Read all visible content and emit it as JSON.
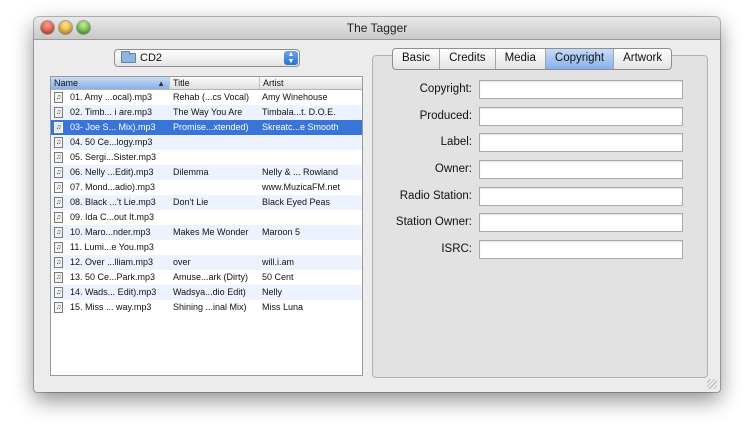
{
  "window": {
    "title": "The Tagger"
  },
  "folder_popup": {
    "selected": "CD2"
  },
  "table": {
    "columns": [
      "Name",
      "Title",
      "Artist"
    ],
    "rows": [
      {
        "name": "01. Amy ...ocal).mp3",
        "title": "Rehab (...cs Vocal)",
        "artist": "Amy Winehouse"
      },
      {
        "name": "02. Timb... i are.mp3",
        "title": "The Way You Are",
        "artist": "Timbala...t. D.O.E."
      },
      {
        "name": "03- Joe S... Mix).mp3",
        "title": "Promise...xtended)",
        "artist": "Skreatc...e Smooth"
      },
      {
        "name": "04. 50 Ce...logy.mp3",
        "title": "",
        "artist": ""
      },
      {
        "name": "05. Sergi...Sister.mp3",
        "title": "",
        "artist": ""
      },
      {
        "name": "06. Nelly ...Edit).mp3",
        "title": "Dilemma",
        "artist": "Nelly & ... Rowland"
      },
      {
        "name": "07. Mond...adio).mp3",
        "title": "",
        "artist": "www.MuzicaFM.net"
      },
      {
        "name": "08. Black ...'t Lie.mp3",
        "title": "Don't Lie",
        "artist": "Black Eyed Peas"
      },
      {
        "name": "09. Ida C...out It.mp3",
        "title": "",
        "artist": ""
      },
      {
        "name": "10. Maro...nder.mp3",
        "title": "Makes Me Wonder",
        "artist": "Maroon 5"
      },
      {
        "name": "11. Lumi...e You.mp3",
        "title": "",
        "artist": ""
      },
      {
        "name": "12. Over ...lliam.mp3",
        "title": "over",
        "artist": "will.i.am"
      },
      {
        "name": "13. 50 Ce...Park.mp3",
        "title": "Amuse...ark (Dirty)",
        "artist": "50 Cent"
      },
      {
        "name": "14. Wads... Edit).mp3",
        "title": "Wadsya...dio Edit)",
        "artist": "Nelly"
      },
      {
        "name": "15. Miss ... way.mp3",
        "title": "Shining ...inal Mix)",
        "artist": "Miss Luna"
      }
    ]
  },
  "tabs": {
    "items": [
      "Basic",
      "Credits",
      "Media",
      "Copyright",
      "Artwork"
    ],
    "active": "Copyright"
  },
  "fields": [
    {
      "label": "Copyright:",
      "value": ""
    },
    {
      "label": "Produced:",
      "value": ""
    },
    {
      "label": "Label:",
      "value": ""
    },
    {
      "label": "Owner:",
      "value": ""
    },
    {
      "label": "Radio Station:",
      "value": ""
    },
    {
      "label": "Station Owner:",
      "value": ""
    },
    {
      "label": "ISRC:",
      "value": ""
    }
  ],
  "colors": {
    "selection": "#3875d7",
    "alt_row": "#edf3fe",
    "active_tab": "#86b1ea"
  }
}
